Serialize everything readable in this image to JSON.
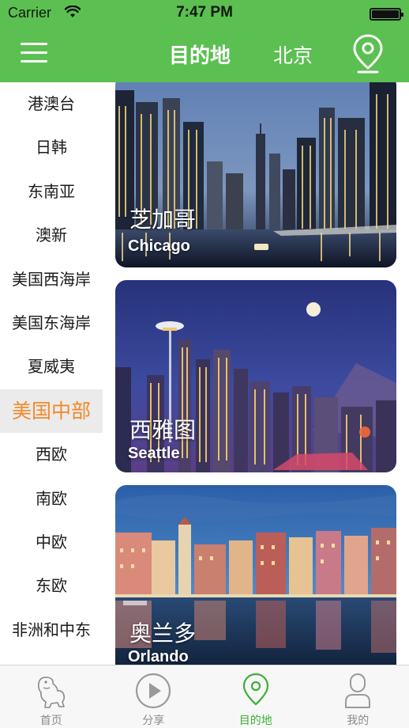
{
  "status_bar": {
    "carrier": "Carrier",
    "time": "7:47 PM"
  },
  "nav": {
    "title": "目的地",
    "city": "北京"
  },
  "sidebar": {
    "items": [
      {
        "label": "港澳台"
      },
      {
        "label": "日韩"
      },
      {
        "label": "东南亚"
      },
      {
        "label": "澳新"
      },
      {
        "label": "美国西海岸"
      },
      {
        "label": "美国东海岸"
      },
      {
        "label": "夏威夷"
      },
      {
        "label": "美国中部"
      },
      {
        "label": "西欧"
      },
      {
        "label": "南欧"
      },
      {
        "label": "中欧"
      },
      {
        "label": "东欧"
      },
      {
        "label": "非洲和中东"
      }
    ],
    "selected_index": 7
  },
  "cities": [
    {
      "name_cn": "芝加哥",
      "name_en": "Chicago"
    },
    {
      "name_cn": "西雅图",
      "name_en": "Seattle"
    },
    {
      "name_cn": "奥兰多",
      "name_en": "Orlando"
    }
  ],
  "tabbar": {
    "tabs": [
      {
        "label": "首页",
        "icon": "dinosaur-icon"
      },
      {
        "label": "分享",
        "icon": "play-icon"
      },
      {
        "label": "目的地",
        "icon": "location-pin-icon"
      },
      {
        "label": "我的",
        "icon": "person-icon"
      }
    ],
    "active_index": 2
  },
  "colors": {
    "brand_green": "#5cbf52",
    "selected_orange": "#f08a2a",
    "active_tab_green": "#3fae37"
  }
}
